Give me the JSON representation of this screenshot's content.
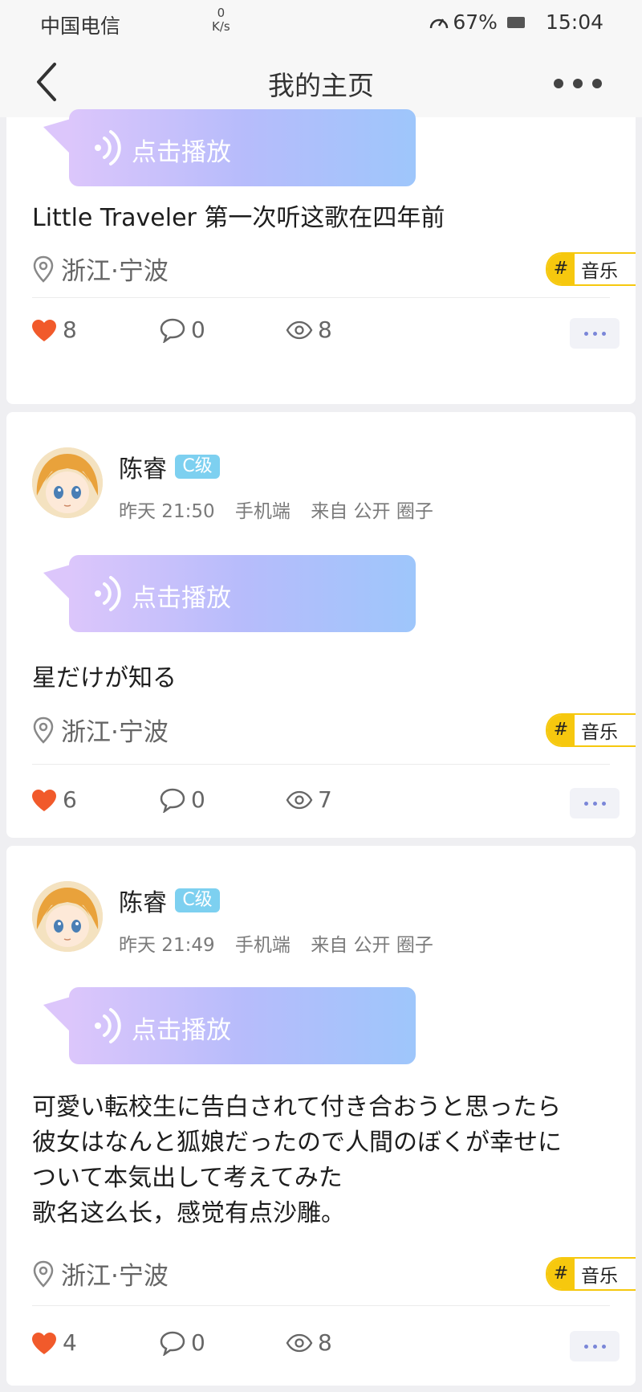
{
  "status_bar": {
    "carrier": "中国电信",
    "net_speed_value": "0",
    "net_speed_unit": "K/s",
    "battery": "67%",
    "time": "15:04"
  },
  "header": {
    "title": "我的主页"
  },
  "posts": [
    {
      "voice_label": "点击播放",
      "text": "Little Traveler 第一次听这歌在四年前",
      "location": "浙江·宁波",
      "tag_hash": "#",
      "tag": "音乐",
      "likes": "8",
      "comments": "0",
      "views": "8"
    },
    {
      "author": "陈睿",
      "level": "C级",
      "date": "昨天 21:50",
      "device": "手机端",
      "source": "来自 公开 圈子",
      "voice_label": "点击播放",
      "text": "星だけが知る",
      "location": "浙江·宁波",
      "tag_hash": "#",
      "tag": "音乐",
      "likes": "6",
      "comments": "0",
      "views": "7"
    },
    {
      "author": "陈睿",
      "level": "C级",
      "date": "昨天 21:49",
      "device": "手机端",
      "source": "来自 公开 圈子",
      "voice_label": "点击播放",
      "text_lines": [
        "可愛い転校生に告白されて付き合おうと思ったら",
        "彼女はなんと狐娘だったので人間のぼくが幸せに",
        "ついて本気出して考えてみた",
        "歌名这么长，感觉有点沙雕。"
      ],
      "location": "浙江·宁波",
      "tag_hash": "#",
      "tag": "音乐",
      "likes": "4",
      "comments": "0",
      "views": "8"
    }
  ],
  "colors": {
    "like": "#f15a2b",
    "tag_accent": "#f6c80e",
    "level_badge": "#7dd0f0",
    "voice_gradient_start": "#dcc6fb",
    "voice_gradient_end": "#9ec6fb"
  }
}
